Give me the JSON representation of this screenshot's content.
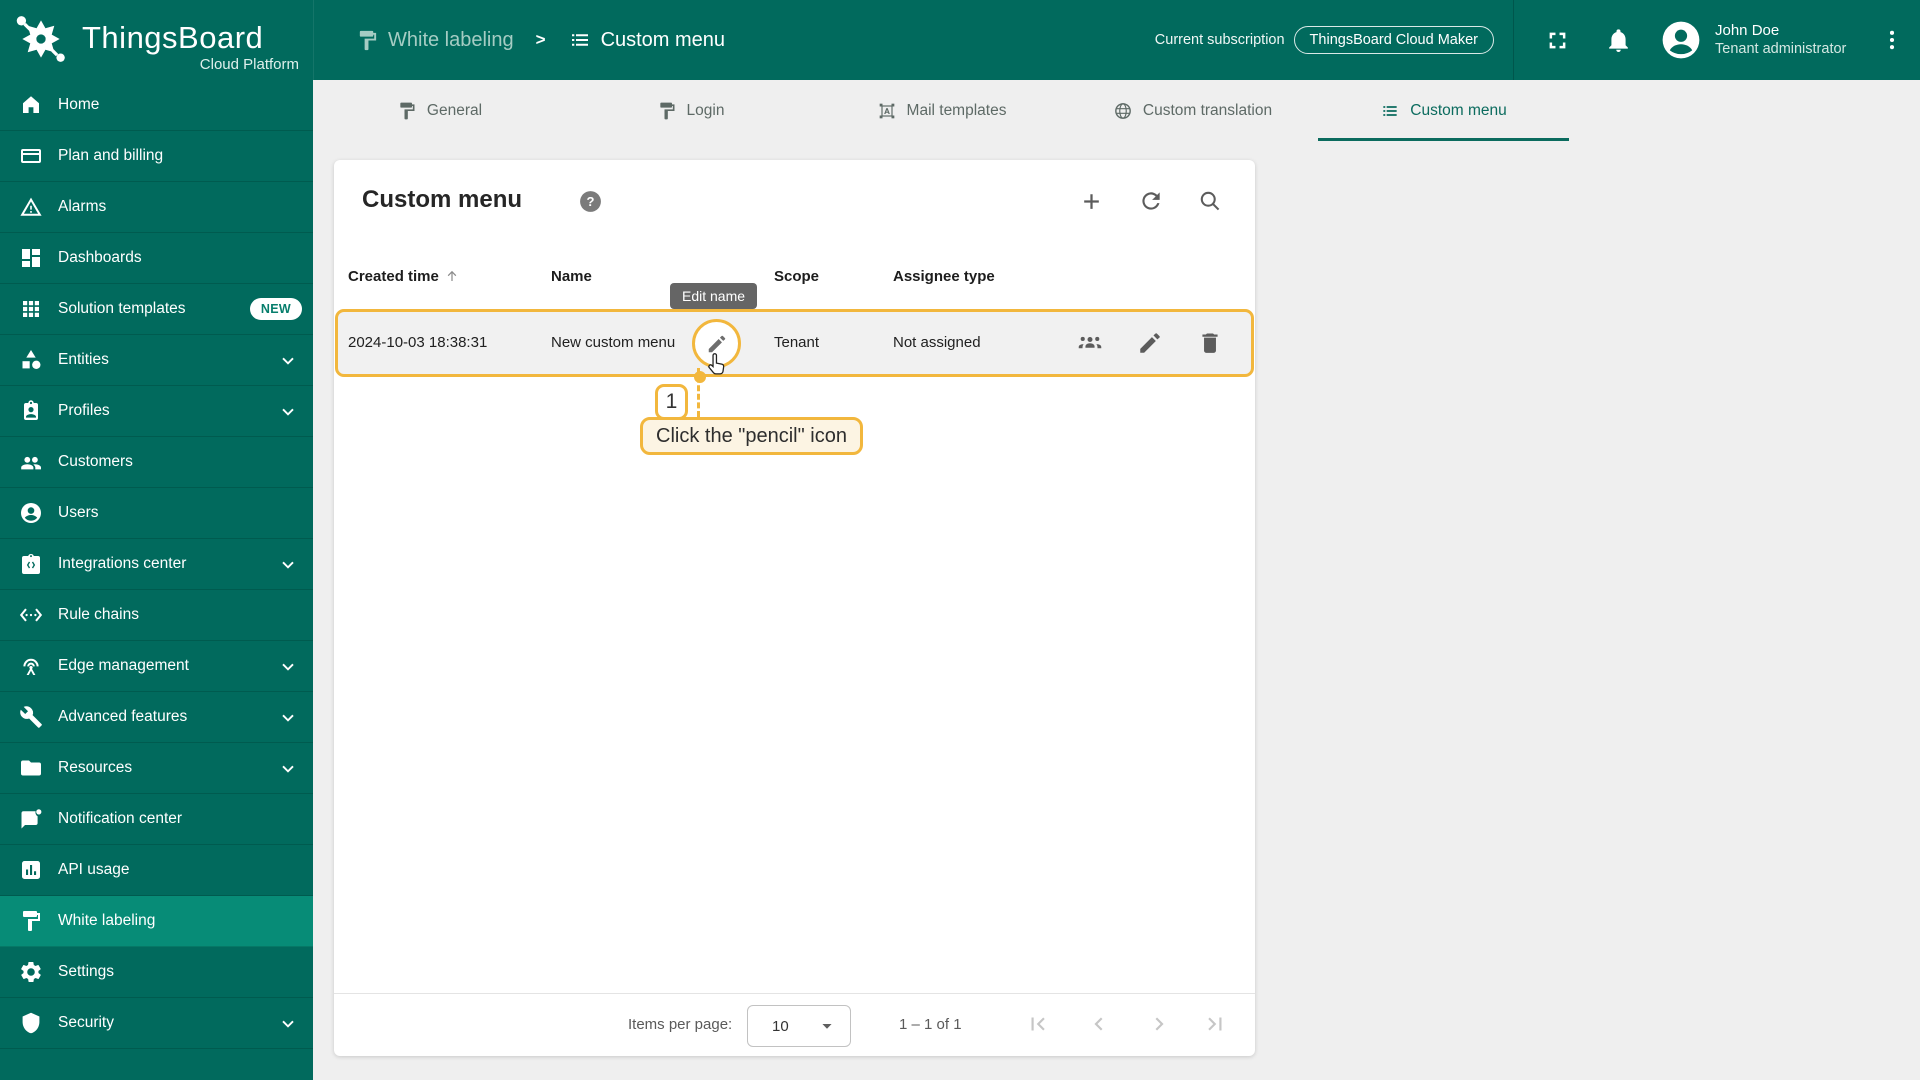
{
  "brand": {
    "name": "ThingsBoard",
    "subtitle": "Cloud Platform"
  },
  "header": {
    "breadcrumb": {
      "parent": "White labeling",
      "separator": ">",
      "current": "Custom menu"
    },
    "subscription": {
      "label": "Current subscription",
      "plan": "ThingsBoard Cloud Maker"
    },
    "user": {
      "name": "John Doe",
      "role": "Tenant administrator"
    }
  },
  "sidebar": {
    "items": [
      {
        "label": "Home",
        "icon": "home"
      },
      {
        "label": "Plan and billing",
        "icon": "credit-card"
      },
      {
        "label": "Alarms",
        "icon": "warning"
      },
      {
        "label": "Dashboards",
        "icon": "dashboard"
      },
      {
        "label": "Solution templates",
        "icon": "apps-grid",
        "badge": "NEW"
      },
      {
        "label": "Entities",
        "icon": "category",
        "expandable": true
      },
      {
        "label": "Profiles",
        "icon": "badge-id",
        "expandable": true
      },
      {
        "label": "Customers",
        "icon": "people"
      },
      {
        "label": "Users",
        "icon": "account-circle"
      },
      {
        "label": "Integrations center",
        "icon": "integration",
        "expandable": true
      },
      {
        "label": "Rule chains",
        "icon": "ethernet"
      },
      {
        "label": "Edge management",
        "icon": "antenna",
        "expandable": true
      },
      {
        "label": "Advanced features",
        "icon": "build",
        "expandable": true
      },
      {
        "label": "Resources",
        "icon": "folder",
        "expandable": true
      },
      {
        "label": "Notification center",
        "icon": "notification"
      },
      {
        "label": "API usage",
        "icon": "api-chart"
      },
      {
        "label": "White labeling",
        "icon": "format-paint",
        "active": true
      },
      {
        "label": "Settings",
        "icon": "settings-gear"
      },
      {
        "label": "Security",
        "icon": "shield",
        "expandable": true
      }
    ]
  },
  "tabs": {
    "items": [
      {
        "label": "General",
        "icon": "format-paint"
      },
      {
        "label": "Login",
        "icon": "format-paint"
      },
      {
        "label": "Mail templates",
        "icon": "text-box"
      },
      {
        "label": "Custom translation",
        "icon": "globe"
      },
      {
        "label": "Custom menu",
        "icon": "list-menu",
        "active": true
      }
    ]
  },
  "panel": {
    "title": "Custom menu",
    "columns": [
      "Created time",
      "Name",
      "Scope",
      "Assignee type"
    ],
    "sort": {
      "column": "Created time",
      "direction": "asc"
    },
    "rows": [
      {
        "created_time": "2024-10-03 18:38:31",
        "name": "New custom menu",
        "scope": "Tenant",
        "assignee_type": "Not assigned"
      }
    ],
    "pagination": {
      "label": "Items per page:",
      "page_size": "10",
      "range": "1 – 1 of 1"
    }
  },
  "tooltip": {
    "text": "Edit name"
  },
  "annotation": {
    "step": "1",
    "instruction": "Click the \"pencil\" icon"
  },
  "colors": {
    "sidebar": "#016A5D",
    "sidebar_active": "#078C77",
    "accent": "#0B6B5E",
    "annotation": "#F2B73D",
    "tooltip_bg": "#656565"
  }
}
